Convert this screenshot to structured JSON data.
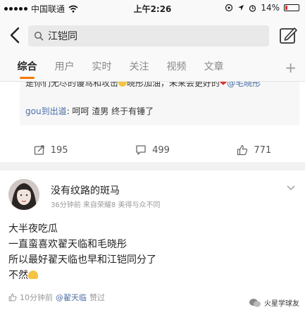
{
  "status_bar": {
    "carrier": "中国联通",
    "time": "上午2:26",
    "battery": "14%",
    "battery_level": 0.14
  },
  "search": {
    "query": "江铠同"
  },
  "tabs": [
    {
      "label": "综合",
      "active": true
    },
    {
      "label": "用户",
      "active": false
    },
    {
      "label": "实时",
      "active": false
    },
    {
      "label": "关注",
      "active": false
    },
    {
      "label": "视频",
      "active": false
    },
    {
      "label": "文章",
      "active": false
    }
  ],
  "tabs_more": "+",
  "comments": {
    "first_text": "是你们无尽的谩骂和攻击",
    "first_text_2": "晓彤加油，未来会更好的",
    "first_mention": "@毛晓彤",
    "second_user": "gou到出道",
    "second_text": ": 呵呵 渣男 终于有锤了"
  },
  "actions": {
    "repost": "195",
    "comment": "499",
    "like": "771"
  },
  "post": {
    "username": "没有纹路的斑马",
    "meta": "36分钟前  来自荣耀8 美得与众不同",
    "lines": [
      "大半夜吃瓜",
      "一直蛮喜欢翟天临和毛晓彤",
      "所以最好翟天临也早和江铠同分了",
      "不然"
    ],
    "footer_time": "10分钟前",
    "footer_mention": "@翟天临",
    "footer_action": "赞过"
  },
  "watermark": "火星学球友",
  "colors": {
    "accent": "#f57a00",
    "link": "#4c6fa3",
    "heart": "#e03131"
  }
}
